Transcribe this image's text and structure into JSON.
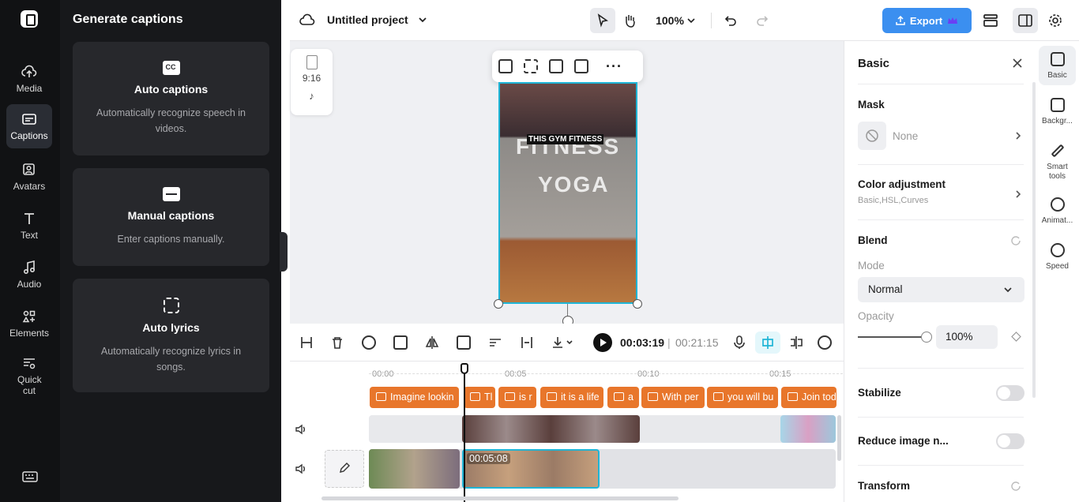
{
  "rail": {
    "items": [
      {
        "label": "Media",
        "icon": "cloud-upload-icon"
      },
      {
        "label": "Captions",
        "icon": "captions-icon",
        "active": true
      },
      {
        "label": "Avatars",
        "icon": "avatar-icon"
      },
      {
        "label": "Text",
        "icon": "text-icon"
      },
      {
        "label": "Audio",
        "icon": "music-note-icon"
      },
      {
        "label": "Elements",
        "icon": "elements-icon"
      },
      {
        "label": "Quick cut",
        "icon": "quick-cut-icon"
      }
    ]
  },
  "panel": {
    "title": "Generate captions",
    "cards": [
      {
        "title": "Auto captions",
        "desc": "Automatically recognize speech in videos.",
        "icon": "cc-icon"
      },
      {
        "title": "Manual captions",
        "desc": "Enter captions manually.",
        "icon": "subtitle-icon"
      },
      {
        "title": "Auto lyrics",
        "desc": "Automatically recognize lyrics in songs.",
        "icon": "lyrics-icon"
      }
    ]
  },
  "topbar": {
    "project_name": "Untitled project",
    "zoom": "100%",
    "export_label": "Export",
    "accent": "#3b8ff0"
  },
  "canvas": {
    "ratio": "9:16",
    "caption_text": "THIS GYM FITNESS",
    "overlay_text_1": "FITNESS",
    "overlay_text_2": "YOGA"
  },
  "playback": {
    "current_time": "00:03:19",
    "total_time": "00:21:15"
  },
  "timeline": {
    "ticks": [
      "00:00",
      "00:05",
      "00:10",
      "00:15"
    ],
    "caption_clips": [
      "Imagine lookin",
      "Tl",
      "is r",
      "it is a life",
      "a",
      "With per",
      "you will bu",
      "Join tod"
    ],
    "selected_clip_duration": "00:05:08",
    "caption_color": "#e8762b"
  },
  "right_panel": {
    "title": "Basic",
    "mask_label": "Mask",
    "mask_value": "None",
    "color_adj_label": "Color adjustment",
    "color_adj_sub": "Basic,HSL,Curves",
    "blend_label": "Blend",
    "mode_label": "Mode",
    "mode_value": "Normal",
    "opacity_label": "Opacity",
    "opacity_value": "100%",
    "stabilize_label": "Stabilize",
    "reduce_noise_label": "Reduce image n...",
    "transform_label": "Transform"
  },
  "right_rail": {
    "items": [
      "Basic",
      "Backgr...",
      "Smart tools",
      "Animat...",
      "Speed"
    ]
  }
}
